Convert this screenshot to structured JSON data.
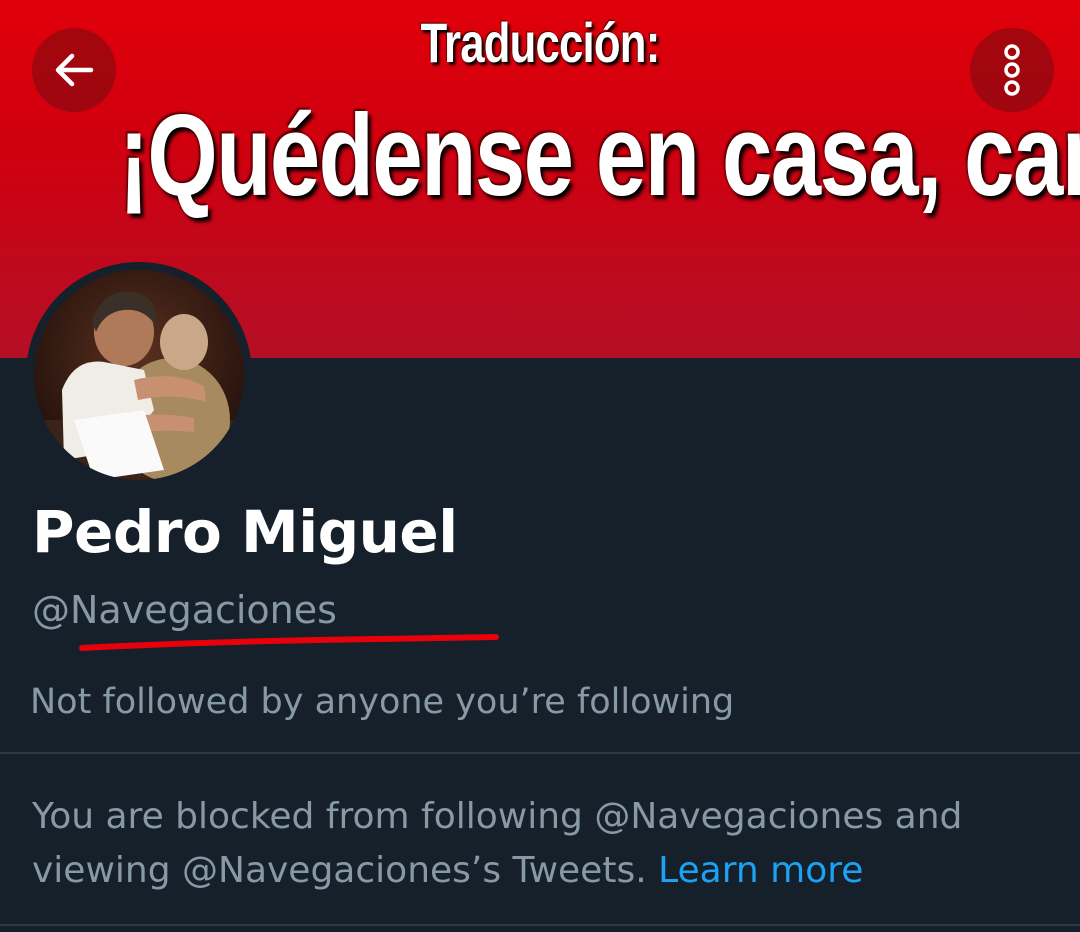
{
  "banner": {
    "subtitle": "Traducción:",
    "title": "¡Quédense en casa, carajo!"
  },
  "nav": {
    "back_icon": "arrow-left-icon",
    "more_icon": "more-vertical-icon"
  },
  "profile": {
    "name": "Pedro Miguel",
    "handle": "@Navegaciones",
    "followed_status": "Not followed by anyone you’re following"
  },
  "blocked_notice": {
    "text": "You are blocked from following @Navegaciones and viewing @Navegaciones’s Tweets.",
    "link": "Learn more"
  },
  "colors": {
    "background": "#15202b",
    "banner_red": "#e00009",
    "secondary_text": "#8899a6",
    "link": "#1da1f2",
    "annotation_red": "#e8000a"
  }
}
